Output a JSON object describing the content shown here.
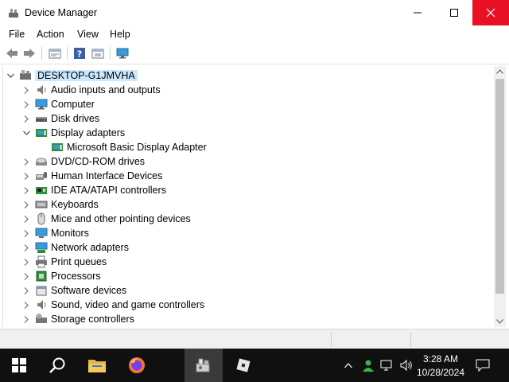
{
  "window": {
    "title": "Device Manager",
    "accent": "#e81123"
  },
  "menu": [
    "File",
    "Action",
    "View",
    "Help"
  ],
  "toolbar": {
    "buttons": [
      "back-icon",
      "forward-icon",
      "properties-icon",
      "help-icon",
      "update-driver-icon",
      "scan-hardware-icon"
    ]
  },
  "tree": {
    "root": "DESKTOP-G1JMVHA",
    "categories": [
      {
        "label": "Audio inputs and outputs",
        "icon": "speaker-icon",
        "expanded": false
      },
      {
        "label": "Computer",
        "icon": "computer-icon",
        "expanded": false
      },
      {
        "label": "Disk drives",
        "icon": "disk-drive-icon",
        "expanded": false
      },
      {
        "label": "Display adapters",
        "icon": "display-adapter-icon",
        "expanded": true,
        "children": [
          "Microsoft Basic Display Adapter"
        ]
      },
      {
        "label": "DVD/CD-ROM drives",
        "icon": "dvd-icon",
        "expanded": false
      },
      {
        "label": "Human Interface Devices",
        "icon": "hid-icon",
        "expanded": false
      },
      {
        "label": "IDE ATA/ATAPI controllers",
        "icon": "ide-icon",
        "expanded": false
      },
      {
        "label": "Keyboards",
        "icon": "keyboard-icon",
        "expanded": false
      },
      {
        "label": "Mice and other pointing devices",
        "icon": "mouse-icon",
        "expanded": false
      },
      {
        "label": "Monitors",
        "icon": "monitor-icon",
        "expanded": false
      },
      {
        "label": "Network adapters",
        "icon": "network-icon",
        "expanded": false
      },
      {
        "label": "Print queues",
        "icon": "printer-icon",
        "expanded": false
      },
      {
        "label": "Processors",
        "icon": "processor-icon",
        "expanded": false
      },
      {
        "label": "Software devices",
        "icon": "software-device-icon",
        "expanded": false
      },
      {
        "label": "Sound, video and game controllers",
        "icon": "speaker-icon",
        "expanded": false
      },
      {
        "label": "Storage controllers",
        "icon": "storage-icon",
        "expanded": false
      }
    ]
  },
  "taskbar": {
    "apps": [
      "windows-start-icon",
      "search-icon",
      "file-explorer-icon",
      "firefox-icon",
      "device-manager-icon",
      "roblox-icon"
    ],
    "time": "3:28 AM",
    "date": "10/28/2024"
  }
}
